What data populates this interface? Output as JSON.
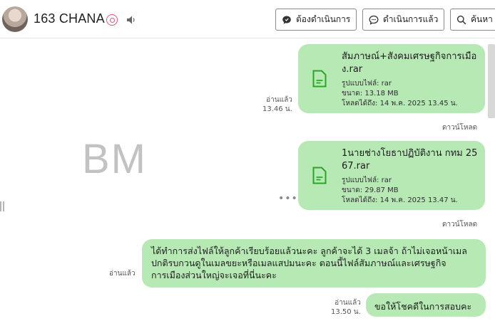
{
  "header": {
    "title": "163 CHANA",
    "buttons": {
      "pending": "ต้องดำเนินการ",
      "done": "ดำเนินการแล้ว",
      "search": "ค้นหา"
    }
  },
  "watermark": "BM",
  "messages": {
    "file_1": {
      "name": "สัมภาษณ์+สังคมเศรษฐกิจการเมือง.rar",
      "format": "รูปแบบไฟล์: rar",
      "size": "ขนาด: 13.18 MB",
      "expires": "โหลดได้ถึง: 14 พ.ค. 2025 13.45 น.",
      "read": "อ่านแล้ว",
      "time": "13.46 น.",
      "download": "ดาวน์โหลด"
    },
    "file_2": {
      "name": "1นายช่างโยธาปฏิบัติงาน กทม 2567.rar",
      "format": "รูปแบบไฟล์: rar",
      "size": "ขนาด: 29.87 MB",
      "expires": "โหลดได้ถึง: 14 พ.ค. 2025 13.47 น.",
      "download": "ดาวน์โหลด",
      "more": "•••"
    },
    "text_1": {
      "body": "ได้ทำการส่งไฟล์ให้ลูกค้าเรียบร้อยแล้วนะคะ ลูกค้าจะได้ 3 เมลจ้า ถ้าไม่เจอหน้าเมลปกติรบกวนดูในเมลขยะหรือเมลแสปมนะคะ ตอนนี้ไฟล์สัมภาษณ์และเศรษฐกิจการเมืองส่วนใหญ่จะเจอที่นี่นะคะ",
      "read": "อ่านแล้ว"
    },
    "text_2": {
      "body": "ขอให้โชคดีในการสอบคะ",
      "read": "อ่านแล้ว",
      "time": "13.50 น."
    }
  },
  "colors": {
    "bubble": "#b7e9b5",
    "file_icon": "#2aa52a",
    "status_icon": "#e0557a"
  },
  "icons": [
    "status-icon",
    "speaker-icon",
    "chat-bubble-icon",
    "search-icon",
    "file-icon"
  ]
}
